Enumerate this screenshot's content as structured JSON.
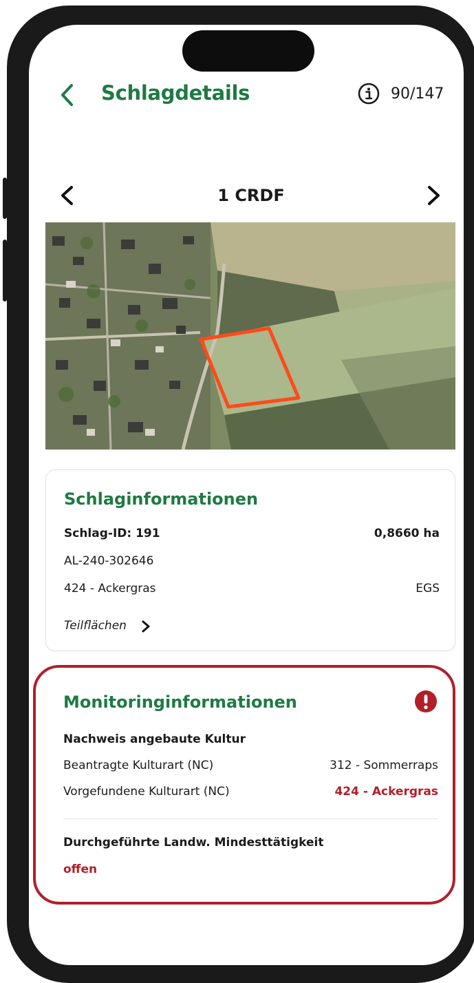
{
  "header": {
    "title": "Schlagdetails",
    "counter": "90/147",
    "back_icon": "chevron-left-icon",
    "info_icon": "info-icon"
  },
  "navigator": {
    "title": "1 CRDF",
    "prev_icon": "chevron-left-icon",
    "next_icon": "chevron-right-icon"
  },
  "schlaginfo": {
    "title": "Schlaginformationen",
    "schlag_id": "Schlag-ID: 191",
    "area": "0,8660 ha",
    "al_code": "AL-240-302646",
    "kultur": "424 - Ackergras",
    "kultur_code": "EGS",
    "teilflaechen_label": "Teilflächen"
  },
  "monitoring": {
    "title": "Monitoringinformationen",
    "alert_icon": "exclamation-circle-icon",
    "section1_title": "Nachweis angebaute Kultur",
    "beantragt_label": "Beantragte Kulturart (NC)",
    "beantragt_value": "312 - Sommerraps",
    "vorgefunden_label": "Vorgefundene Kulturart (NC)",
    "vorgefunden_value": "424 - Ackergras",
    "section2_title": "Durchgeführte Landw. Mindesttätigkeit",
    "status": "offen"
  },
  "colors": {
    "brand_green": "#1e7a43",
    "alert_red": "#b01f2a",
    "parcel_outline": "#ff4a1a"
  }
}
